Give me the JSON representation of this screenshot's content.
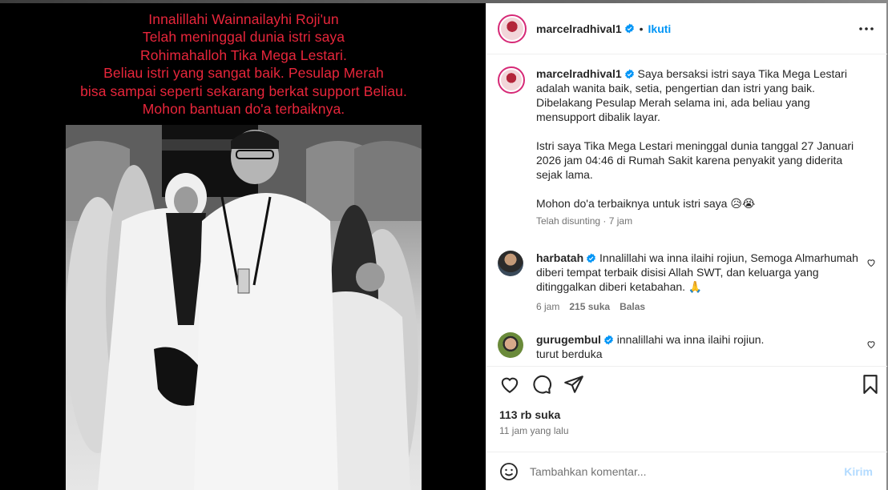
{
  "post": {
    "image_caption_lines": [
      "Innalillahi Wainnailayhi Roji'un",
      "Telah meninggal dunia istri saya",
      "Rohimahalloh Tika Mega Lestari.",
      "Beliau istri yang sangat baik. Pesulap Merah",
      "bisa sampai seperti sekarang berkat support Beliau.",
      "Mohon bantuan do'a terbaiknya."
    ]
  },
  "header": {
    "username": "marcelradhival1",
    "separator": "•",
    "follow_label": "Ikuti"
  },
  "caption": {
    "username": "marcelradhival1",
    "paragraphs": [
      "Saya bersaksi istri saya Tika Mega Lestari adalah wanita baik, setia, pengertian dan istri yang baik. Dibelakang Pesulap Merah selama ini, ada beliau yang mensupport dibalik layar.",
      "Istri saya Tika Mega Lestari meninggal dunia tanggal 27 Januari 2026 jam 04:46 di Rumah Sakit karena penyakit yang diderita sejak lama.",
      "Mohon do'a terbaiknya untuk istri saya 😥😭"
    ],
    "edited": "Telah disunting · 7 jam"
  },
  "comments": [
    {
      "username": "harbatah",
      "text": "Innalillahi wa inna ilaihi rojiun, Semoga Almarhumah diberi tempat terbaik disisi Allah SWT, dan keluarga yang ditinggalkan diberi ketabahan. 🙏",
      "time": "6 jam",
      "likes": "215 suka",
      "reply": "Balas"
    },
    {
      "username": "gurugembul",
      "text": "innalillahi wa inna ilaihi rojiun.",
      "text2": "turut berduka"
    }
  ],
  "stats": {
    "likes": "113 rb suka",
    "time_ago": "11 jam yang lalu"
  },
  "comment_box": {
    "placeholder": "Tambahkan komentar...",
    "post_label": "Kirim"
  },
  "colors": {
    "caption_red": "#e8263b",
    "link_blue": "#0095f6",
    "verified_blue": "#0095f6",
    "muted": "#737373"
  }
}
